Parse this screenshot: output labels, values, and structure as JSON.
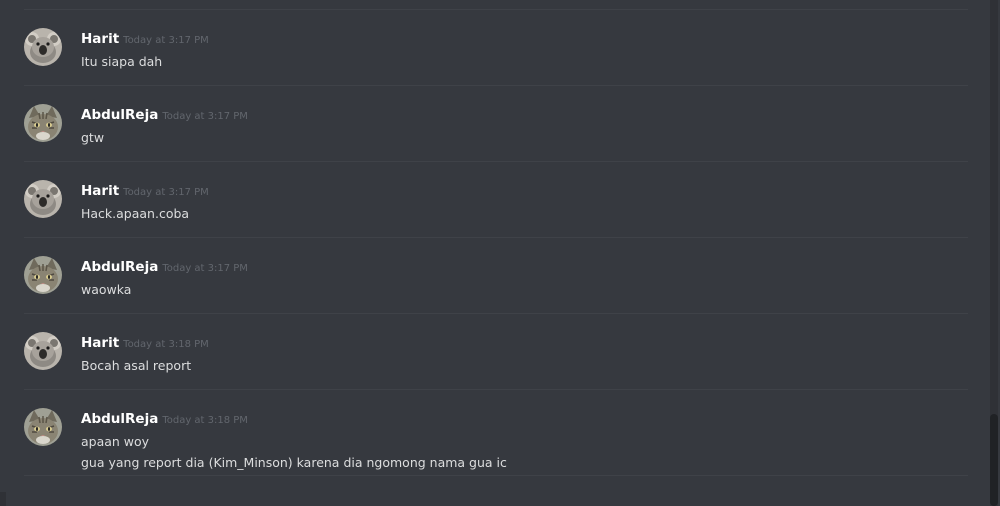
{
  "colors": {
    "background": "#36393f",
    "username": "#ffffff",
    "timestamp": "#62666d",
    "message_text": "#dcddde",
    "divider": "#3f4248"
  },
  "messages": [
    {
      "username": "Harit",
      "timestamp": "Today at 3:17 PM",
      "avatar": "koala-avatar",
      "lines": [
        "Itu siapa dah"
      ]
    },
    {
      "username": "AbdulReja",
      "timestamp": "Today at 3:17 PM",
      "avatar": "cat-avatar",
      "lines": [
        "gtw"
      ]
    },
    {
      "username": "Harit",
      "timestamp": "Today at 3:17 PM",
      "avatar": "koala-avatar",
      "lines": [
        "Hack.apaan.coba"
      ]
    },
    {
      "username": "AbdulReja",
      "timestamp": "Today at 3:17 PM",
      "avatar": "cat-avatar",
      "lines": [
        "waowka"
      ]
    },
    {
      "username": "Harit",
      "timestamp": "Today at 3:18 PM",
      "avatar": "koala-avatar",
      "lines": [
        "Bocah asal report"
      ]
    },
    {
      "username": "AbdulReja",
      "timestamp": "Today at 3:18 PM",
      "avatar": "cat-avatar",
      "lines": [
        "apaan woy",
        "gua yang report dia (Kim_Minson) karena dia ngomong nama gua ic"
      ]
    }
  ]
}
